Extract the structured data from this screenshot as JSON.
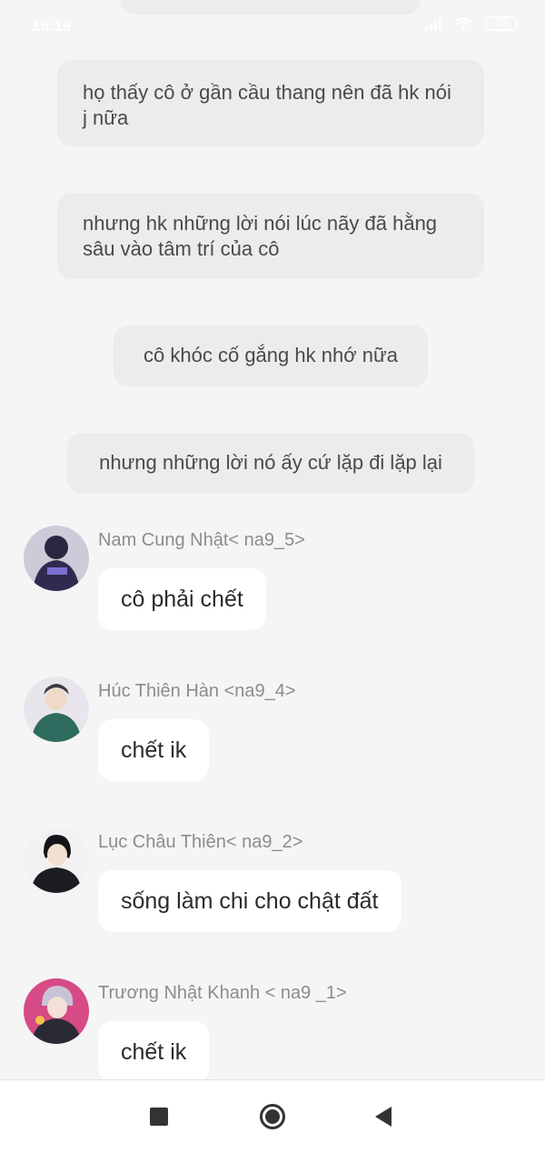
{
  "status_bar": {
    "time": "18:19",
    "battery": "100"
  },
  "narration": [
    "họ thấy cô ở gần cầu thang nên đã hk nói j nữa",
    "nhưng hk những lời nói lúc nãy đã hằng sâu vào tâm trí của cô",
    "cô khóc cố gắng hk nhớ nữa",
    "nhưng những lời nó ấy cứ lặp đi lặp lại"
  ],
  "messages": [
    {
      "sender": "Nam Cung Nhật< na9_5>",
      "text": "cô phải chết",
      "avatar_color": "#3a3560"
    },
    {
      "sender": "Húc Thiên Hàn <na9_4>",
      "text": "chết ik",
      "avatar_color": "#2f6b5e"
    },
    {
      "sender": "Lục Châu Thiên< na9_2>",
      "text": "sống làm chi cho chật đất",
      "avatar_color": "#1c1c22"
    },
    {
      "sender": "Trương Nhật Khanh < na9 _1>",
      "text": "chết ik",
      "avatar_color": "#b0306a"
    }
  ],
  "nav": {
    "recents_icon": "square-icon",
    "home_icon": "circle-icon",
    "back_icon": "triangle-back-icon"
  }
}
